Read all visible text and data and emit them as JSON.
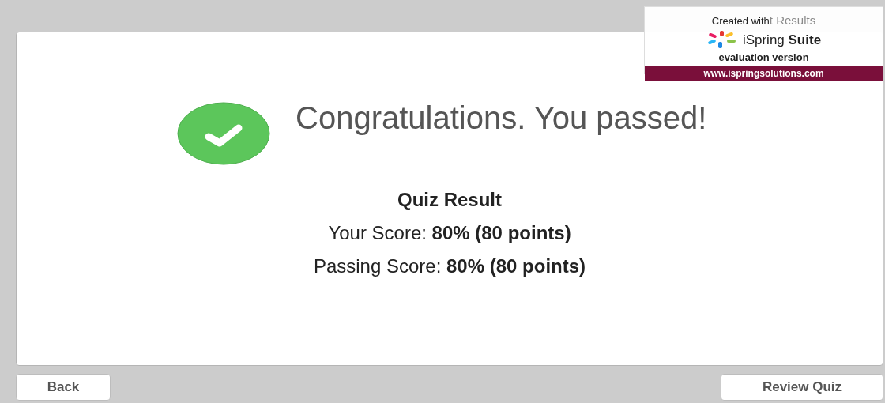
{
  "header": {
    "title_fragment": "t Results"
  },
  "badge": {
    "created_with": "Created with",
    "product": "iSpring **Suite**",
    "edition": "evaluation version",
    "url": "www.ispringsolutions.com"
  },
  "result": {
    "passed": true,
    "message": "Congratulations. You passed!",
    "heading": "Quiz Result",
    "lines": [
      {
        "label": "Your Score:",
        "value": "80% (80 points)"
      },
      {
        "label": "Passing Score:",
        "value": "80% (80 points)"
      }
    ]
  },
  "buttons": [
    {
      "label": "Back",
      "kind": "back"
    },
    {
      "label": "Review Quiz",
      "kind": "review"
    }
  ]
}
